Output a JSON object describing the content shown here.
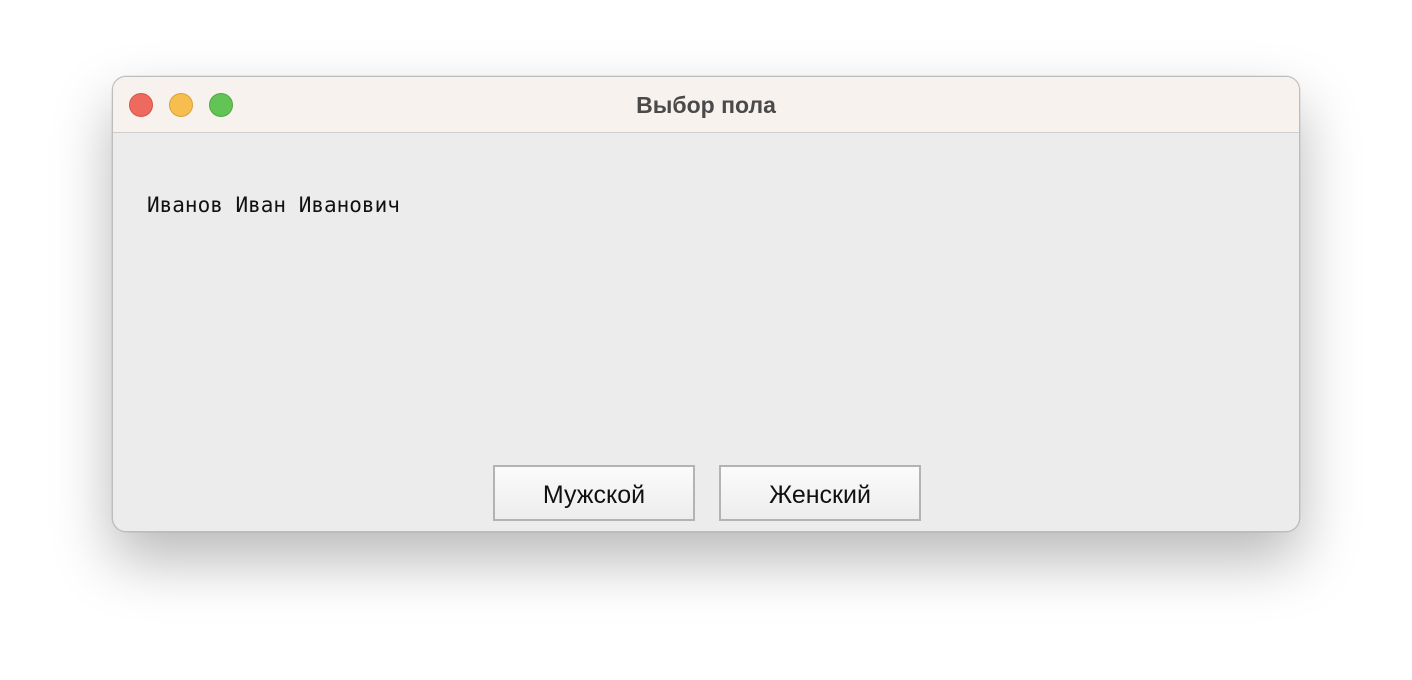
{
  "window": {
    "title": "Выбор пола"
  },
  "content": {
    "person_name": "Иванов Иван Иванович"
  },
  "buttons": {
    "male_label": "Мужской",
    "female_label": "Женский"
  },
  "icons": {
    "close": "close-traffic-light",
    "minimize": "minimize-traffic-light",
    "zoom": "zoom-traffic-light"
  },
  "colors": {
    "close": "#ee6a5e",
    "minimize": "#f5be4f",
    "zoom": "#61c454",
    "titlebar": "#f7f2ee",
    "window_bg": "#ececec"
  }
}
